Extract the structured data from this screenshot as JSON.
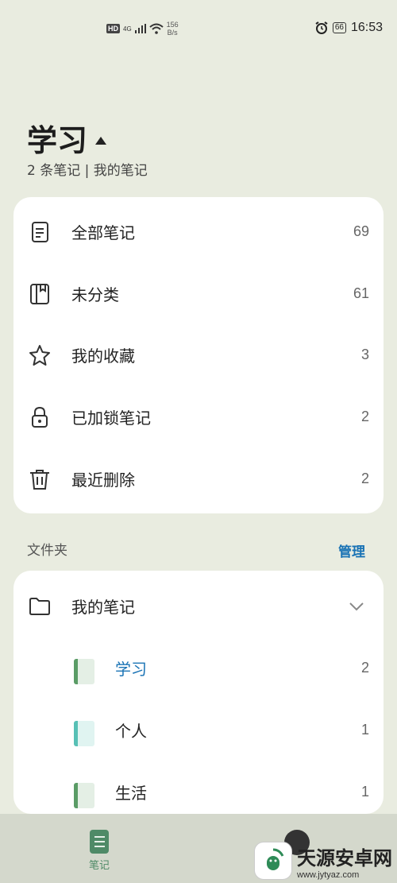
{
  "status_bar": {
    "hd": "HD",
    "net": "4G",
    "speed_value": "156",
    "speed_unit": "B/s",
    "battery": "66",
    "time": "16:53"
  },
  "header": {
    "title": "学习",
    "subtitle": "2 条笔记 | 我的笔记"
  },
  "categories": [
    {
      "label": "全部笔记",
      "count": "69",
      "icon": "note-icon"
    },
    {
      "label": "未分类",
      "count": "61",
      "icon": "notebook-icon"
    },
    {
      "label": "我的收藏",
      "count": "3",
      "icon": "star-icon"
    },
    {
      "label": "已加锁笔记",
      "count": "2",
      "icon": "lock-icon"
    },
    {
      "label": "最近删除",
      "count": "2",
      "icon": "trash-icon"
    }
  ],
  "folders": {
    "section_title": "文件夹",
    "manage_label": "管理",
    "root": {
      "label": "我的笔记",
      "icon": "folder-icon"
    },
    "items": [
      {
        "label": "学习",
        "count": "2",
        "color": "#5a9c66"
      },
      {
        "label": "个人",
        "count": "1",
        "color": "#57c0b5"
      },
      {
        "label": "生活",
        "count": "1",
        "color": "#5a9c66"
      }
    ]
  },
  "bottom_nav": {
    "notes_label": "笔记"
  },
  "watermark": {
    "title": "天源安卓网",
    "url": "www.jytyaz.com"
  },
  "colors": {
    "background": "#e9ece0",
    "accent_blue": "#1a73b5",
    "accent_green": "#4f8a67"
  }
}
